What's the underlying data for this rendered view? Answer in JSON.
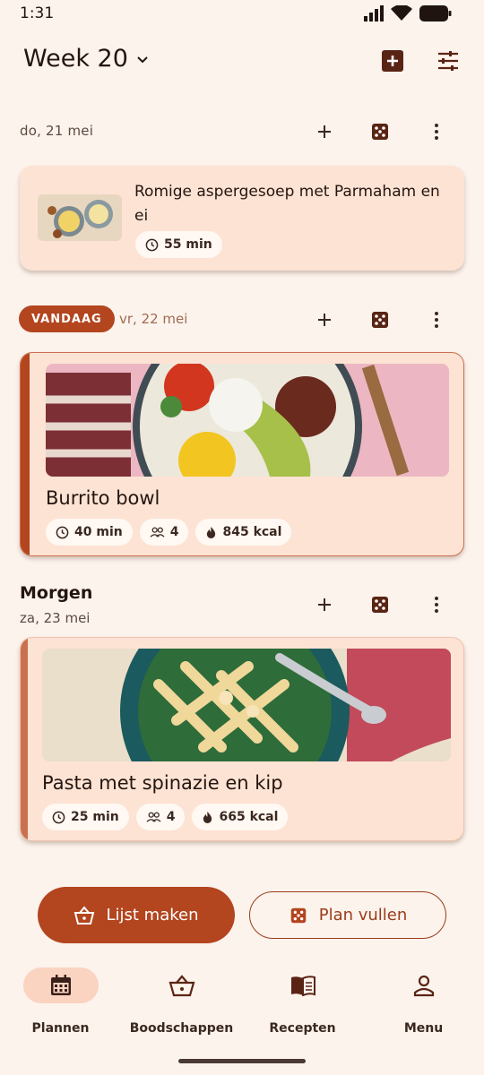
{
  "status_bar": {
    "time": "1:31"
  },
  "header": {
    "week_title": "Week 20"
  },
  "days": [
    {
      "date": "do, 21 mei",
      "meal": {
        "title": "Romige aspergesoep met Parmaham en ei",
        "time": "55 min"
      }
    },
    {
      "badge": "VANDAAG",
      "date": "vr, 22 mei",
      "meal": {
        "title": "Burrito bowl",
        "time": "40 min",
        "servings": "4",
        "calories": "845 kcal"
      }
    },
    {
      "label": "Morgen",
      "date": "za, 23 mei",
      "meal": {
        "title": "Pasta met spinazie en kip",
        "time": "25 min",
        "servings": "4",
        "calories": "665 kcal"
      }
    }
  ],
  "actions": {
    "make_list": "Lijst maken",
    "fill_plan": "Plan vullen"
  },
  "nav": {
    "items": [
      {
        "label": "Plannen",
        "icon": "calendar-icon"
      },
      {
        "label": "Boodschappen",
        "icon": "basket-icon"
      },
      {
        "label": "Recepten",
        "icon": "book-icon"
      },
      {
        "label": "Menu",
        "icon": "person-icon"
      }
    ]
  },
  "colors": {
    "accent": "#b3451f",
    "background": "#fcf3ec",
    "card": "#fde3d4"
  }
}
